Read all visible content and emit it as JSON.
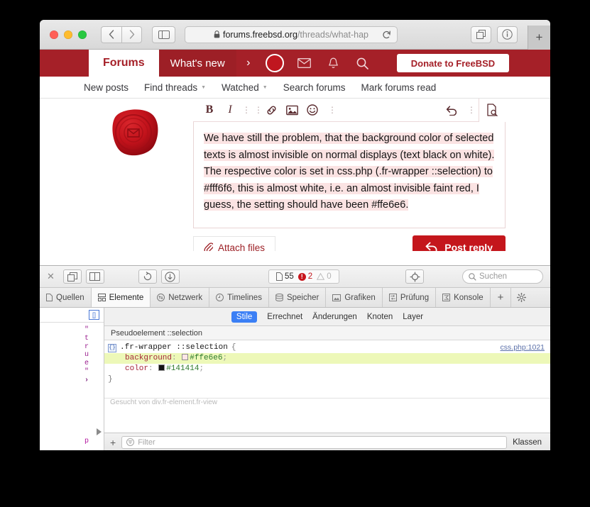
{
  "window": {
    "traffic_lights": [
      "close",
      "minimize",
      "zoom"
    ],
    "toolbar": {
      "back_icon": "‹",
      "forward_icon": "›",
      "sidebar_icon": "sidebar-icon",
      "tabs_overview_icon": "tabs-overview-icon",
      "info_icon": "info-icon",
      "new_tab_icon": "+"
    },
    "url": {
      "lock_icon": "🔒",
      "host": "forums.freebsd.org",
      "path": "/threads/what-hap",
      "reload_icon": "⟳",
      "full": "forums.freebsd.org/threads/what-hap"
    }
  },
  "forum": {
    "brand": "Forums",
    "whats_new": "What's new",
    "chevron": "›",
    "icons": [
      "avatar-circle",
      "mail-icon",
      "bell-icon",
      "search-icon"
    ],
    "donate_label": "Donate to FreeBSD",
    "accent_color": "#a52028",
    "subnav": [
      {
        "label": "New posts",
        "has_caret": false
      },
      {
        "label": "Find threads",
        "has_caret": true
      },
      {
        "label": "Watched",
        "has_caret": true
      },
      {
        "label": "Search forums",
        "has_caret": false
      },
      {
        "label": "Mark forums read",
        "has_caret": false
      }
    ]
  },
  "editor": {
    "toolbar_icons": [
      "bold",
      "italic",
      "more",
      "more",
      "link",
      "image",
      "emoji",
      "more",
      "undo",
      "more",
      "preview"
    ],
    "bold_label": "B",
    "italic_label": "I",
    "post_text": "We have still the problem, that the background color of selected texts is almost invisible on normal displays (text black on white). The respective color is set in css.php (.fr-wrapper ::selection) to #fff6f6, this is almost white, i.e. an almost invisible faint red, I guess, the setting should have been #ffe6e6.",
    "selection_background": "#fbe3e3",
    "attach_label": "Attach files",
    "attach_icon": "paperclip-icon",
    "post_reply_label": "Post reply",
    "post_reply_icon": "reply-arrow-icon",
    "post_reply_color": "#c4161c"
  },
  "inspector": {
    "close_icon": "✕",
    "dock_bottom_icon": "dock-bottom-icon",
    "dock_side_icon": "dock-side-icon",
    "reload_icon": "reload-icon",
    "download_icon": "download-icon",
    "counts": {
      "resources": "55",
      "errors": "2",
      "warnings": "0",
      "resource_icon": "document-icon",
      "error_icon": "error-icon",
      "warning_icon": "warning-icon"
    },
    "inspect_element_icon": "crosshair-icon",
    "search_placeholder": "Suchen",
    "search_icon": "search-icon",
    "tabs": [
      {
        "label": "Quellen",
        "icon": "document-icon",
        "active": false
      },
      {
        "label": "Elemente",
        "icon": "elements-icon",
        "active": true
      },
      {
        "label": "Netzwerk",
        "icon": "network-icon",
        "active": false
      },
      {
        "label": "Timelines",
        "icon": "clock-icon",
        "active": false
      },
      {
        "label": "Speicher",
        "icon": "storage-icon",
        "active": false
      },
      {
        "label": "Grafiken",
        "icon": "graphics-icon",
        "active": false
      },
      {
        "label": "Prüfung",
        "icon": "audit-icon",
        "active": false
      },
      {
        "label": "Konsole",
        "icon": "console-icon",
        "active": false
      }
    ],
    "tab_add_icon": "+",
    "tab_settings_icon": "gear-icon",
    "dom": {
      "node_badge": "[]",
      "vertical_fragment": [
        "\"",
        "t",
        "r",
        "u",
        "e",
        "\"",
        "›"
      ],
      "bottom_char": "p",
      "expand_icon": "triangle-right-icon"
    },
    "style_tabs": [
      {
        "label": "Stile",
        "active": true
      },
      {
        "label": "Errechnet",
        "active": false
      },
      {
        "label": "Änderungen",
        "active": false
      },
      {
        "label": "Knoten",
        "active": false
      },
      {
        "label": "Layer",
        "active": false
      }
    ],
    "style_tab_active_color": "#3b7ff5",
    "pseudo_header": "Pseudoelement ::selection",
    "rule": {
      "badge": "{}",
      "selector": ".fr-wrapper ::selection",
      "open_brace": "{",
      "close_brace": "}",
      "origin": "css.php:1021",
      "declarations": [
        {
          "property": "background",
          "value": "#ffe6e6",
          "swatch": "#ffe6e6",
          "highlighted": true
        },
        {
          "property": "color",
          "value": "#141414",
          "swatch": "#141414",
          "highlighted": false
        }
      ]
    },
    "ghost_text": "Gesucht von div.fr-element.fr-view",
    "filter": {
      "plus_icon": "+",
      "placeholder": "Filter",
      "filter_icon": "filter-icon",
      "classes_label": "Klassen"
    },
    "console_prompt": "›"
  }
}
